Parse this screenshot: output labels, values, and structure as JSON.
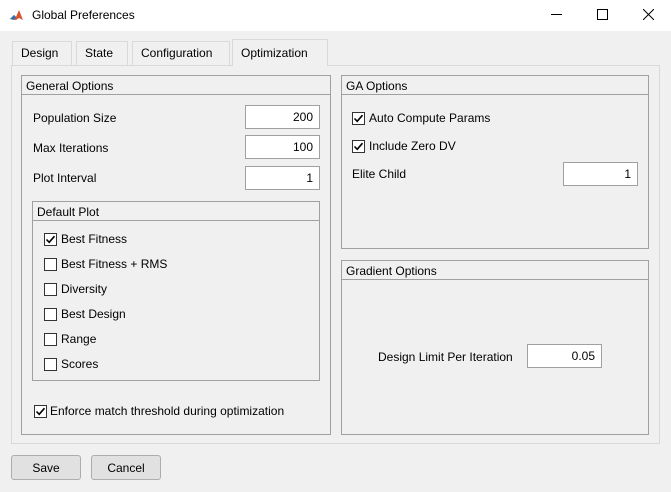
{
  "window": {
    "title": "Global Preferences",
    "icon": "matlab-icon",
    "controls": [
      "minimize-icon",
      "maximize-icon",
      "close-icon"
    ]
  },
  "tabs": [
    {
      "label": "Design",
      "active": false
    },
    {
      "label": "State",
      "active": false
    },
    {
      "label": "Configuration",
      "active": false
    },
    {
      "label": "Optimization",
      "active": true
    }
  ],
  "general_options": {
    "title": "General Options",
    "population_size_label": "Population Size",
    "population_size_value": "200",
    "max_iterations_label": "Max Iterations",
    "max_iterations_value": "100",
    "plot_interval_label": "Plot Interval",
    "plot_interval_value": "1",
    "default_plot": {
      "title": "Default Plot",
      "items": [
        {
          "label": "Best Fitness",
          "checked": true
        },
        {
          "label": "Best Fitness + RMS",
          "checked": false
        },
        {
          "label": "Diversity",
          "checked": false
        },
        {
          "label": "Best Design",
          "checked": false
        },
        {
          "label": "Range",
          "checked": false
        },
        {
          "label": "Scores",
          "checked": false
        }
      ]
    },
    "enforce_label": "Enforce match threshold during optimization",
    "enforce_checked": true
  },
  "ga_options": {
    "title": "GA Options",
    "auto_compute_label": "Auto Compute Params",
    "auto_compute_checked": true,
    "include_zero_label": "Include Zero DV",
    "include_zero_checked": true,
    "elite_child_label": "Elite Child",
    "elite_child_value": "1"
  },
  "gradient_options": {
    "title": "Gradient Options",
    "design_limit_label": "Design Limit Per Iteration",
    "design_limit_value": "0.05"
  },
  "footer": {
    "save_label": "Save",
    "cancel_label": "Cancel"
  },
  "colors": {
    "titlebar_bg": "#ffffff",
    "dialog_bg": "#f0f0f0",
    "border": "#a0a0a0"
  }
}
